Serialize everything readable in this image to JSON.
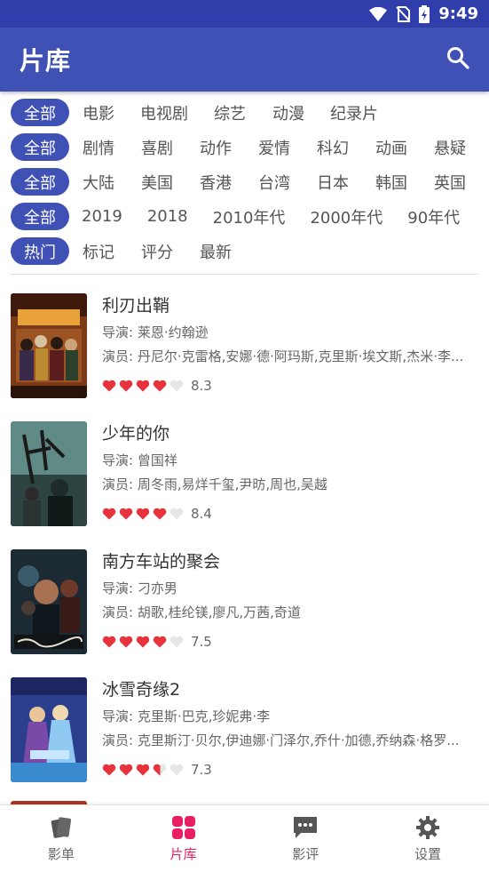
{
  "status_bar": {
    "time": "9:49"
  },
  "app_bar": {
    "title": "片库"
  },
  "filters": {
    "type": [
      "全部",
      "电影",
      "电视剧",
      "综艺",
      "动漫",
      "纪录片"
    ],
    "genre": [
      "全部",
      "剧情",
      "喜剧",
      "动作",
      "爱情",
      "科幻",
      "动画",
      "悬疑"
    ],
    "region": [
      "全部",
      "大陆",
      "美国",
      "香港",
      "台湾",
      "日本",
      "韩国",
      "英国"
    ],
    "year": [
      "全部",
      "2019",
      "2018",
      "2010年代",
      "2000年代",
      "90年代"
    ],
    "sort": [
      "热门",
      "标记",
      "评分",
      "最新"
    ]
  },
  "movies": [
    {
      "title": "利刃出鞘",
      "director": "导演: 莱恩·约翰逊",
      "cast": "演员: 丹尼尔·克雷格,安娜·德·阿玛斯,克里斯·埃文斯,杰米·李...",
      "rating": 8.3,
      "hearts": [
        1,
        1,
        1,
        1,
        0
      ],
      "score": "8.3"
    },
    {
      "title": "少年的你",
      "director": "导演: 曾国祥",
      "cast": "演员: 周冬雨,易烊千玺,尹昉,周也,吴越",
      "rating": 8.4,
      "hearts": [
        1,
        1,
        1,
        1,
        0
      ],
      "score": "8.4"
    },
    {
      "title": "南方车站的聚会",
      "director": "导演: 刁亦男",
      "cast": "演员: 胡歌,桂纶镁,廖凡,万茜,奇道",
      "rating": 7.5,
      "hearts": [
        1,
        1,
        1,
        1,
        0
      ],
      "score": "7.5"
    },
    {
      "title": "冰雪奇缘2",
      "director": "导演: 克里斯·巴克,珍妮弗·李",
      "cast": "演员: 克里斯汀·贝尔,伊迪娜·门泽尔,乔什·加德,乔纳森·格罗...",
      "rating": 7.3,
      "hearts": [
        1,
        1,
        1,
        0.5,
        0
      ],
      "score": "7.3"
    }
  ],
  "bottom_nav": [
    {
      "label": "影单",
      "icon": "cards-icon",
      "active": false
    },
    {
      "label": "片库",
      "icon": "grid-icon",
      "active": true
    },
    {
      "label": "影评",
      "icon": "comment-icon",
      "active": false
    },
    {
      "label": "设置",
      "icon": "gear-icon",
      "active": false
    }
  ],
  "colors": {
    "primary": "#3f51b5",
    "status_bar": "#2f3eab",
    "accent": "#e91e63",
    "heart": "#e8323c"
  }
}
